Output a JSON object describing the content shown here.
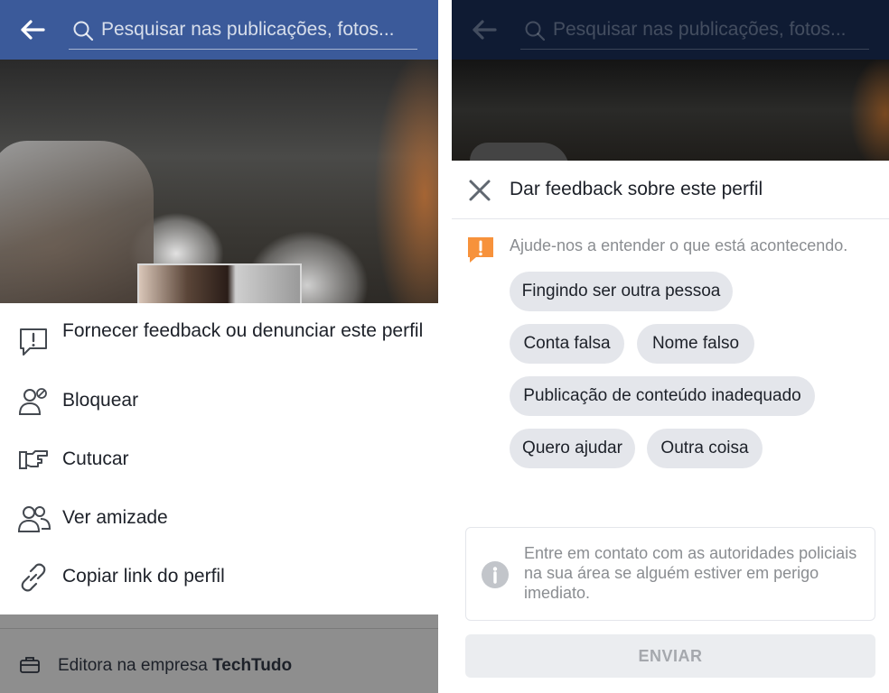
{
  "search": {
    "placeholder": "Pesquisar nas publicações, fotos..."
  },
  "profile_menu": {
    "items": [
      {
        "label": "Fornecer feedback ou denunciar este perfil",
        "icon": "report-icon"
      },
      {
        "label": "Bloquear",
        "icon": "block-user-icon"
      },
      {
        "label": "Cutucar",
        "icon": "poke-icon"
      },
      {
        "label": "Ver amizade",
        "icon": "friendship-icon"
      },
      {
        "label": "Copiar link do perfil",
        "icon": "link-icon"
      }
    ]
  },
  "profile_info": {
    "work_prefix": "Editora na empresa",
    "work_company": "TechTudo",
    "work_icon": "briefcase-icon"
  },
  "feedback_dialog": {
    "title": "Dar feedback sobre este perfil",
    "hint": "Ajude-nos a entender o que está acontecendo.",
    "options": [
      "Fingindo ser outra pessoa",
      "Conta falsa",
      "Nome falso",
      "Publicação de conteúdo inadequado",
      "Quero ajudar",
      "Outra coisa"
    ],
    "notice": "Entre em contato com as autoridades policiais na sua área se alguém estiver em perigo imediato.",
    "submit_label": "ENVIAR"
  },
  "colors": {
    "header_blue": "#3b5a9a",
    "warning_orange": "#f7923b",
    "chip_gray": "#e4e6eb",
    "text_dark": "#1d2129",
    "text_muted": "#8a8d91"
  }
}
